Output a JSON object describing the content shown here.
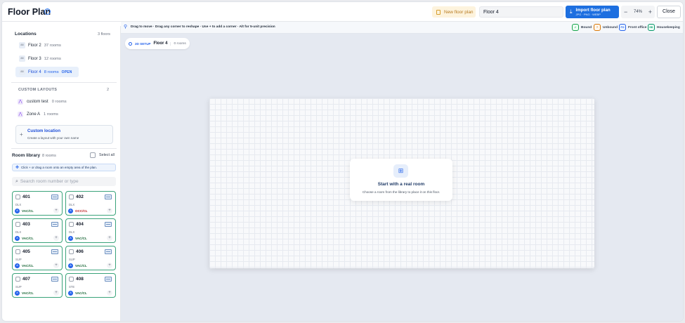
{
  "header": {
    "title": "Floor Plan",
    "new_floor_plan_label": "New floor plan",
    "floor_name_value": "Floor 4",
    "import_label": "Import floor plan",
    "import_formats": "JPG · PNG · WEBP",
    "zoom_level": "74%",
    "zoom_out": "−",
    "zoom_in": "+",
    "close_label": "Close"
  },
  "sidebar": {
    "locations_title": "Locations",
    "locations_count": "3 floors",
    "floors": [
      {
        "icon": "88",
        "name": "Floor 2",
        "count": "37 rooms",
        "badge": ""
      },
      {
        "icon": "88",
        "name": "Floor 3",
        "count": "12 rooms",
        "badge": ""
      },
      {
        "icon": "88",
        "name": "Floor 4",
        "count": "8 rooms",
        "badge": "OPEN"
      }
    ],
    "custom_layouts_title": "CUSTOM LAYOUTS",
    "custom_layouts_count": "2",
    "layouts": [
      {
        "name": "custom test",
        "count": "0 rooms"
      },
      {
        "name": "Zone A",
        "count": "1 rooms"
      }
    ],
    "custom_location": {
      "title": "Custom location",
      "subtitle": "Create a layout with your own name"
    },
    "room_library_title": "Room library",
    "room_library_count": "8 rooms",
    "select_all_label": "Select all",
    "hint": "Click + or drag a room onto an empty area of the plan.",
    "search_placeholder": "Search room number or type",
    "rooms": [
      {
        "number": "401",
        "type": "DLX",
        "avatar": "A",
        "status": "VAC/CL",
        "status_kind": "vacant"
      },
      {
        "number": "402",
        "type": "DLX",
        "avatar": "A",
        "status": "OCC/CL",
        "status_kind": "occupied"
      },
      {
        "number": "403",
        "type": "DLX",
        "avatar": "A",
        "status": "VAC/CL",
        "status_kind": "vacant"
      },
      {
        "number": "404",
        "type": "DLX",
        "avatar": "A",
        "status": "VAC/CL",
        "status_kind": "vacant"
      },
      {
        "number": "405",
        "type": "SUP",
        "avatar": "A",
        "status": "VAC/CL",
        "status_kind": "vacant"
      },
      {
        "number": "406",
        "type": "SUP",
        "avatar": "A",
        "status": "VAC/CL",
        "status_kind": "vacant"
      },
      {
        "number": "407",
        "type": "SUP",
        "avatar": "A",
        "status": "VAC/CL",
        "status_kind": "vacant"
      },
      {
        "number": "408",
        "type": "STE",
        "avatar": "A",
        "status": "VAC/CL",
        "status_kind": "vacant"
      }
    ]
  },
  "toolbar": {
    "instructions": "Drag to move · Drag any corner to reshape · Use + to add a corner · Alt for 5-unit precision",
    "legend": [
      {
        "key": "✓",
        "label": "Bound",
        "color": "#16a34a"
      },
      {
        "key": "?",
        "label": "Unbound",
        "color": "#d97706"
      },
      {
        "key": "FO",
        "label": "Front office",
        "color": "#2563eb"
      },
      {
        "key": "HK",
        "label": "Housekeeping",
        "color": "#059669"
      }
    ]
  },
  "canvas": {
    "setup_label": "2D SETUP",
    "floor_name": "Floor 4",
    "room_count": "0 rooms",
    "empty_title": "Start with a real room",
    "empty_subtitle": "Choose a room from the library to place it on this floor."
  }
}
